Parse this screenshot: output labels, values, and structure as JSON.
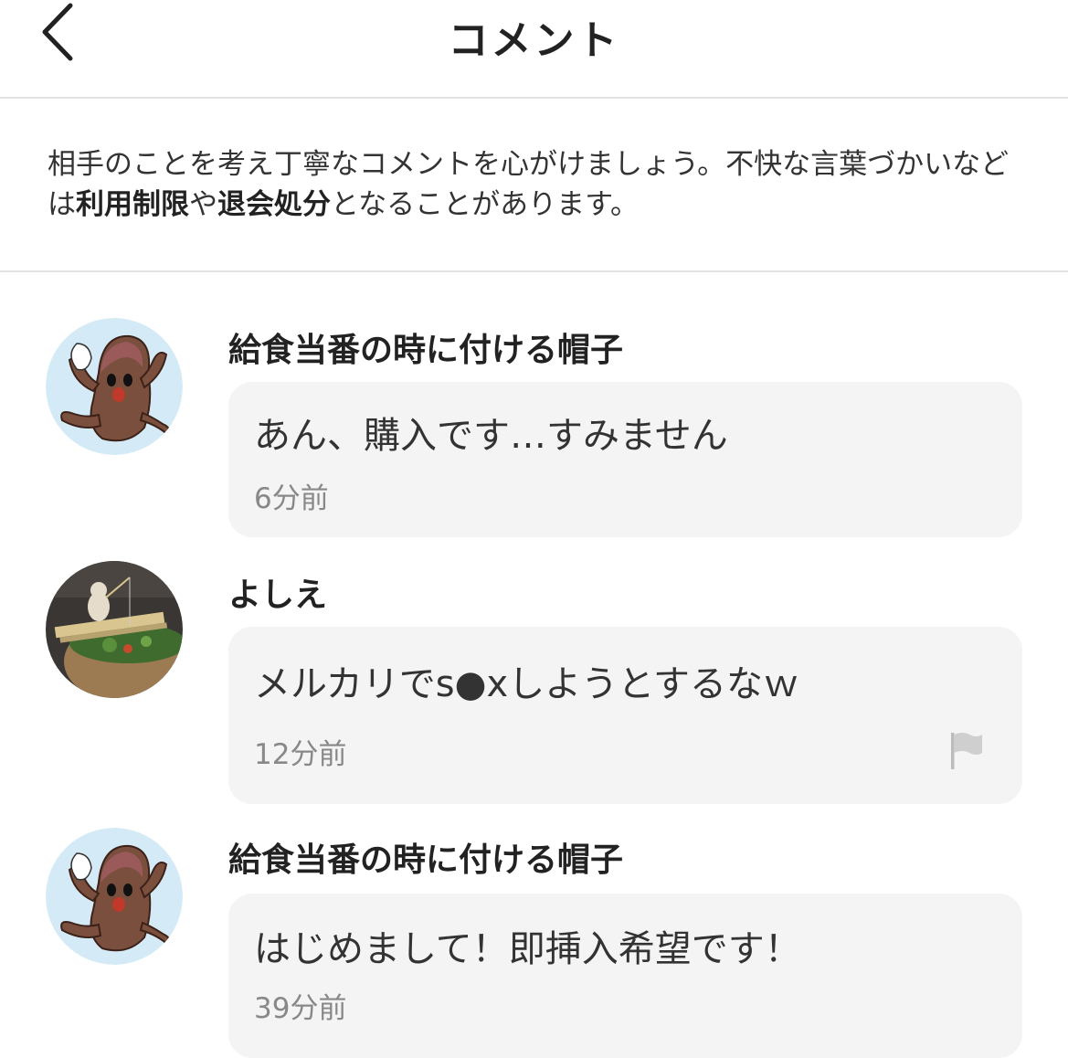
{
  "header": {
    "title": "コメント",
    "back_icon": "chevron-left-icon"
  },
  "notice": {
    "part1": "相手のことを考え丁寧なコメントを心がけましょう。不快な言葉づかいなどは",
    "bold1": "利用制限",
    "part2": "や",
    "bold2": "退会処分",
    "part3": "となることがあります。"
  },
  "comments": [
    {
      "username": "給食当番の時に付ける帽子",
      "text": "あん、購入です…すみません",
      "time": "6分前",
      "avatar_icon": "cartoon-character-avatar"
    },
    {
      "username": "よしえ",
      "text": "メルカリでs●xしようとするなｗ",
      "time": "12分前",
      "avatar_icon": "photo-avatar",
      "flag_icon": "flag-icon"
    },
    {
      "username": "給食当番の時に付ける帽子",
      "text": "はじめまして！即挿入希望です！",
      "time": "39分前",
      "avatar_icon": "cartoon-character-avatar"
    }
  ],
  "colors": {
    "bubble_bg": "#f4f4f4",
    "divider": "#e2e2e2",
    "time_text": "#888888",
    "avatar_bg": "#d4ebf7"
  }
}
